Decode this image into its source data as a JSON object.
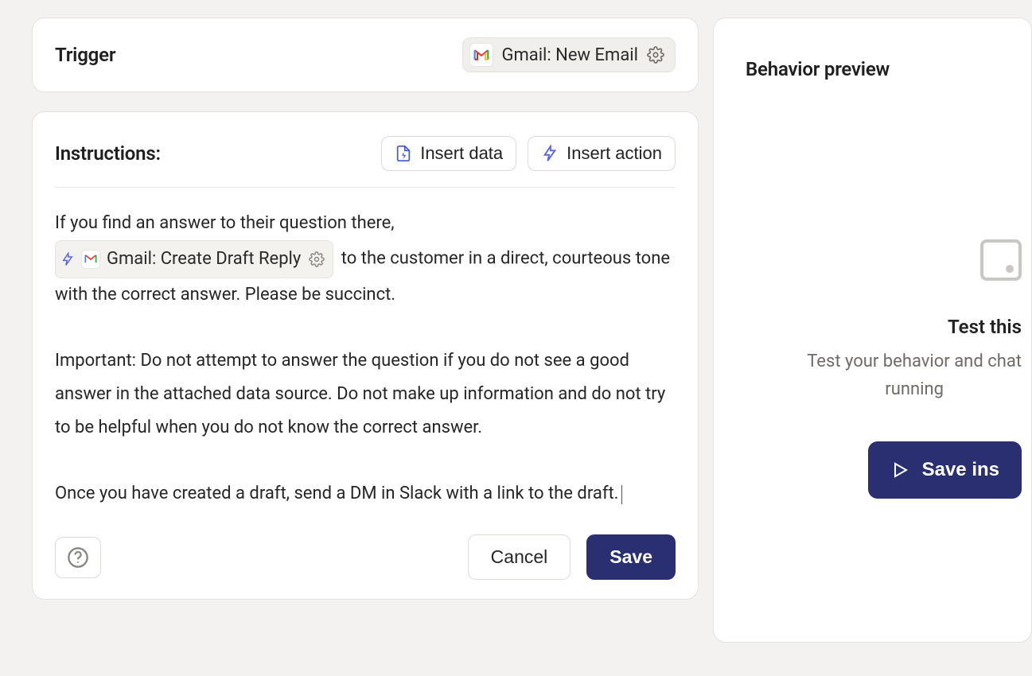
{
  "trigger": {
    "label": "Trigger",
    "chip": {
      "icon": "gmail-icon",
      "text": "Gmail: New Email"
    }
  },
  "instructions": {
    "label": "Instructions:",
    "insert_data_label": "Insert data",
    "insert_action_label": "Insert action",
    "body": {
      "line1_before": "If you find an answer to their question there,",
      "action_chip_text": "Gmail: Create Draft Reply",
      "line1_after": "to the customer in a direct, courteous tone with the correct answer. Please be succinct.",
      "paragraph2": "Important: Do not attempt to answer the question if you do not see a good answer in the attached data source. Do not make up information and do not try to be helpful when you do not know the correct answer.",
      "paragraph3": "Once you have created a draft, send a DM in Slack with a link to the draft."
    },
    "cancel_label": "Cancel",
    "save_label": "Save"
  },
  "preview": {
    "title": "Behavior preview",
    "heading": "Test this",
    "subline1": "Test your behavior and chat",
    "subline2": "running",
    "cta_label": "Save ins"
  }
}
